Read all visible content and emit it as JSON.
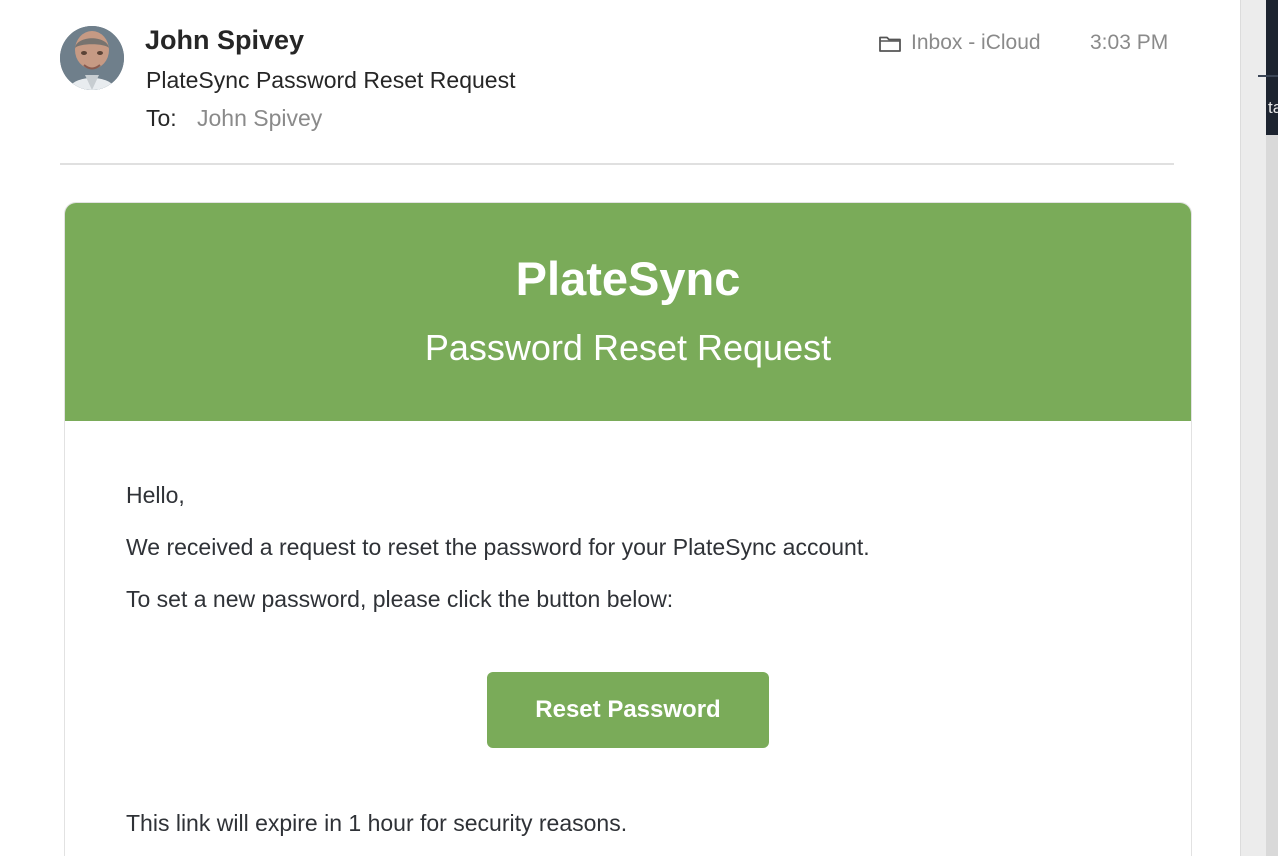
{
  "message": {
    "sender_name": "John Spivey",
    "subject": "PlateSync Password Reset Request",
    "to_label": "To:",
    "to_value": "John Spivey",
    "folder_label": "Inbox - iCloud",
    "time": "3:03 PM"
  },
  "email": {
    "brand": "PlateSync",
    "subtitle": "Password Reset Request",
    "greeting": "Hello,",
    "line1": "We received a request to reset the password for your PlateSync account.",
    "line2": "To set a new password, please click the button below:",
    "button_label": "Reset Password",
    "expire_note": "This link will expire in 1 hour for security reasons."
  },
  "background_window": {
    "visible_text": "ta"
  },
  "colors": {
    "brand_green": "#7aab59",
    "primary_text": "#262626",
    "secondary_text": "#8a8a8a",
    "body_text": "#2f3237"
  },
  "icons": {
    "sender_avatar": "avatar",
    "mailbox": "folder-icon"
  }
}
